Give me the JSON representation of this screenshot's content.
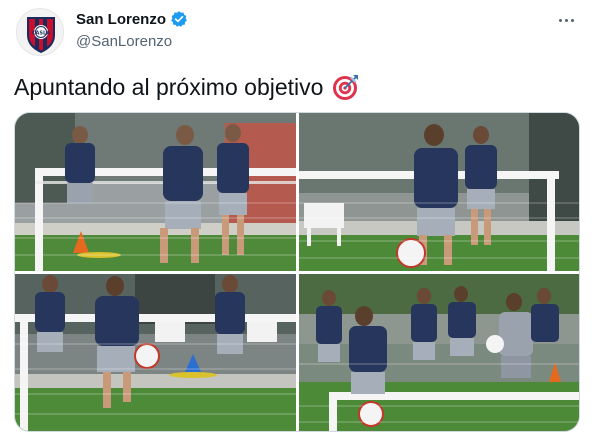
{
  "account": {
    "display_name": "San Lorenzo",
    "handle": "@SanLorenzo",
    "verified": true,
    "avatar_icon": "club-crest-icon",
    "crest_text": "CASLA"
  },
  "tweet": {
    "text": "Apuntando al próximo objetivo",
    "emoji": "direct-hit-target-icon"
  },
  "media": {
    "photos": [
      {
        "subject": "training-photo-1"
      },
      {
        "subject": "training-photo-2"
      },
      {
        "subject": "training-photo-3"
      },
      {
        "subject": "training-photo-4"
      }
    ]
  },
  "colors": {
    "text": "#0f1419",
    "secondary": "#536471",
    "verified": "#1d9bf0",
    "border": "#cfd9de",
    "crest_red": "#c8102e",
    "crest_blue": "#1b2a5c"
  }
}
